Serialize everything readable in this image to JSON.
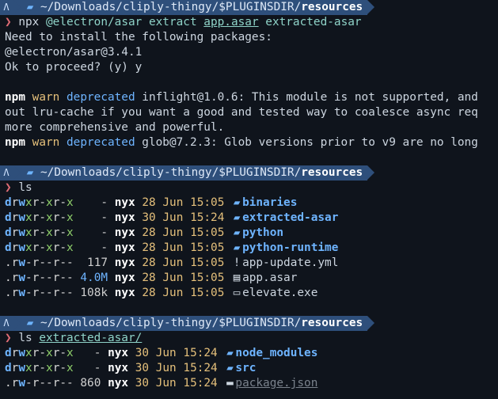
{
  "prompts": [
    {
      "logo": "Λ",
      "path": "~/Downloads/cliply-thingy/$PLUGINSDIR/",
      "dir": "resources"
    },
    {
      "logo": "Λ",
      "path": "~/Downloads/cliply-thingy/$PLUGINSDIR/",
      "dir": "resources"
    },
    {
      "logo": "Λ",
      "path": "~/Downloads/cliply-thingy/$PLUGINSDIR/",
      "dir": "resources"
    }
  ],
  "block1": {
    "cmd": "npx",
    "arg1": "@electron/asar extract",
    "arg2": "app.asar",
    "arg3": "extracted-asar",
    "out1": "Need to install the following packages:",
    "out2": "@electron/asar@3.4.1",
    "out3": "Ok to proceed? (y) y",
    "warn1_npm": "npm",
    "warn1_w": "warn",
    "warn1_d": "deprecated",
    "warn1_msg": " inflight@1.0.6: This module is not supported, and",
    "warn1_cont1": "out lru-cache if you want a good and tested way to coalesce async req",
    "warn1_cont2": "more comprehensive and powerful.",
    "warn2_npm": "npm",
    "warn2_w": "warn",
    "warn2_d": "deprecated",
    "warn2_msg": " glob@7.2.3: Glob versions prior to v9 are no long"
  },
  "block2": {
    "cmd": "ls",
    "rows": [
      {
        "perm": "drwxr-xr-x",
        "size": "   -",
        "user": "nyx",
        "day": "28",
        "mon": "Jun",
        "time": "15:05",
        "name": "binaries",
        "kind": "folder"
      },
      {
        "perm": "drwxr-xr-x",
        "size": "   -",
        "user": "nyx",
        "day": "30",
        "mon": "Jun",
        "time": "15:24",
        "name": "extracted-asar",
        "kind": "folder"
      },
      {
        "perm": "drwxr-xr-x",
        "size": "   -",
        "user": "nyx",
        "day": "28",
        "mon": "Jun",
        "time": "15:05",
        "name": "python",
        "kind": "folder"
      },
      {
        "perm": "drwxr-xr-x",
        "size": "   -",
        "user": "nyx",
        "day": "28",
        "mon": "Jun",
        "time": "15:05",
        "name": "python-runtime",
        "kind": "folder"
      },
      {
        "perm": ".rw-r--r--",
        "size": " 117",
        "user": "nyx",
        "day": "28",
        "mon": "Jun",
        "time": "15:05",
        "name": "app-update.yml",
        "kind": "yml"
      },
      {
        "perm": ".rw-r--r--",
        "size": "4.0M",
        "user": "nyx",
        "day": "28",
        "mon": "Jun",
        "time": "15:05",
        "name": "app.asar",
        "kind": "file"
      },
      {
        "perm": ".rw-r--r--",
        "size": "108k",
        "user": "nyx",
        "day": "28",
        "mon": "Jun",
        "time": "15:05",
        "name": "elevate.exe",
        "kind": "exe"
      }
    ]
  },
  "block3": {
    "cmd": "ls",
    "arg": "extracted-asar/",
    "rows": [
      {
        "perm": "drwxr-xr-x",
        "size": "  -",
        "user": "nyx",
        "day": "30",
        "mon": "Jun",
        "time": "15:24",
        "name": "node_modules",
        "kind": "folder"
      },
      {
        "perm": "drwxr-xr-x",
        "size": "  -",
        "user": "nyx",
        "day": "30",
        "mon": "Jun",
        "time": "15:24",
        "name": "src",
        "kind": "folder"
      },
      {
        "perm": ".rw-r--r--",
        "size": "860",
        "user": "nyx",
        "day": "30",
        "mon": "Jun",
        "time": "15:24",
        "name": "package.json",
        "kind": "json"
      }
    ]
  },
  "icons": {
    "prompt_arrow": "❯",
    "folder": "▰",
    "yml": "!",
    "file": "▤",
    "exe": "▭",
    "json": "▬"
  }
}
